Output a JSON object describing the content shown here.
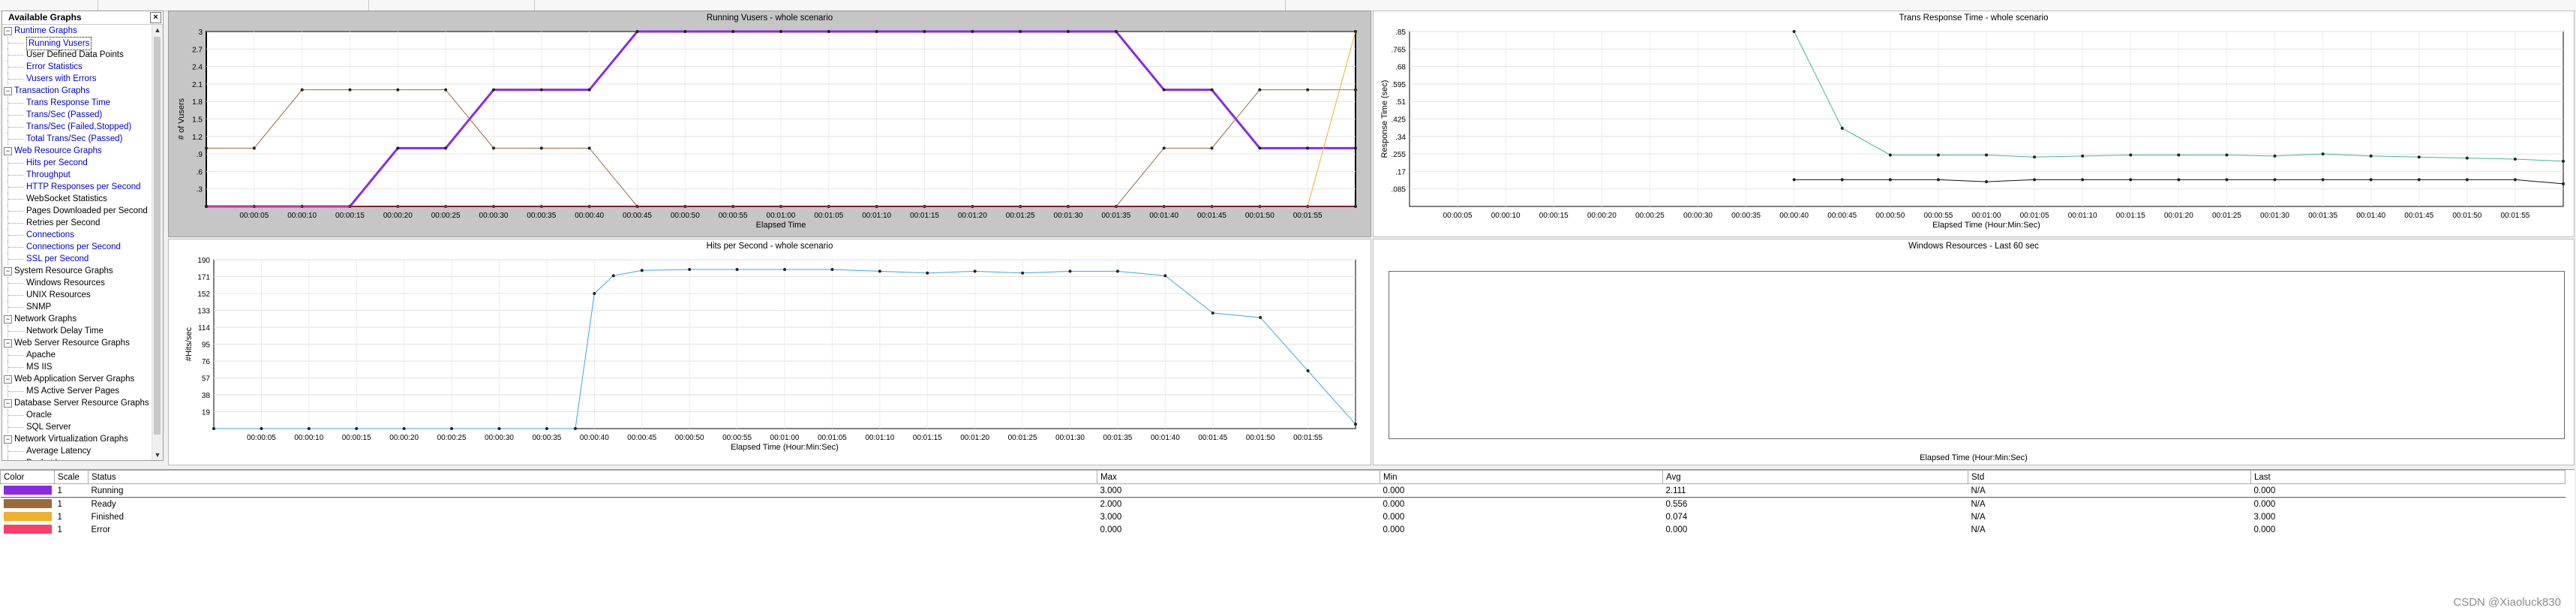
{
  "tree": {
    "title": "Available Graphs",
    "close": "×",
    "items": [
      {
        "label": "Runtime Graphs",
        "level": 0,
        "expander": "−",
        "style": "cat"
      },
      {
        "label": "Running Vusers",
        "level": 1,
        "style": "blue",
        "selected": true
      },
      {
        "label": "User Defined Data Points",
        "level": 1,
        "style": "black"
      },
      {
        "label": "Error Statistics",
        "level": 1,
        "style": "blue"
      },
      {
        "label": "Vusers with Errors",
        "level": 1,
        "style": "blue"
      },
      {
        "label": "Transaction Graphs",
        "level": 0,
        "expander": "−",
        "style": "cat"
      },
      {
        "label": "Trans Response Time",
        "level": 1,
        "style": "blue"
      },
      {
        "label": "Trans/Sec (Passed)",
        "level": 1,
        "style": "blue"
      },
      {
        "label": "Trans/Sec (Failed,Stopped)",
        "level": 1,
        "style": "blue"
      },
      {
        "label": "Total Trans/Sec (Passed)",
        "level": 1,
        "style": "blue"
      },
      {
        "label": "Web Resource Graphs",
        "level": 0,
        "expander": "−",
        "style": "cat"
      },
      {
        "label": "Hits per Second",
        "level": 1,
        "style": "blue"
      },
      {
        "label": "Throughput",
        "level": 1,
        "style": "blue"
      },
      {
        "label": "HTTP Responses per Second",
        "level": 1,
        "style": "blue"
      },
      {
        "label": "WebSocket Statistics",
        "level": 1,
        "style": "black"
      },
      {
        "label": "Pages Downloaded per Second",
        "level": 1,
        "style": "black"
      },
      {
        "label": "Retries per Second",
        "level": 1,
        "style": "black"
      },
      {
        "label": "Connections",
        "level": 1,
        "style": "blue"
      },
      {
        "label": "Connections per Second",
        "level": 1,
        "style": "blue"
      },
      {
        "label": "SSL per Second",
        "level": 1,
        "style": "blue"
      },
      {
        "label": "System Resource Graphs",
        "level": 0,
        "expander": "−",
        "style": "black"
      },
      {
        "label": "Windows Resources",
        "level": 1,
        "style": "black"
      },
      {
        "label": "UNIX Resources",
        "level": 1,
        "style": "black"
      },
      {
        "label": "SNMP",
        "level": 1,
        "style": "black"
      },
      {
        "label": "Network Graphs",
        "level": 0,
        "expander": "−",
        "style": "black"
      },
      {
        "label": "Network Delay Time",
        "level": 1,
        "style": "black"
      },
      {
        "label": "Web Server Resource Graphs",
        "level": 0,
        "expander": "−",
        "style": "black"
      },
      {
        "label": "Apache",
        "level": 1,
        "style": "black"
      },
      {
        "label": "MS IIS",
        "level": 1,
        "style": "black"
      },
      {
        "label": "Web Application Server Graphs",
        "level": 0,
        "expander": "−",
        "style": "black"
      },
      {
        "label": "MS Active Server Pages",
        "level": 1,
        "style": "black"
      },
      {
        "label": "Database Server Resource Graphs",
        "level": 0,
        "expander": "−",
        "style": "black"
      },
      {
        "label": "Oracle",
        "level": 1,
        "style": "black"
      },
      {
        "label": "SQL Server",
        "level": 1,
        "style": "black"
      },
      {
        "label": "Network Virtualization Graphs",
        "level": 0,
        "expander": "−",
        "style": "black"
      },
      {
        "label": "Average Latency",
        "level": 1,
        "style": "black"
      },
      {
        "label": "Packet Loss",
        "level": 1,
        "style": "black"
      }
    ]
  },
  "time_ticks": [
    "00:00:05",
    "00:00:10",
    "00:00:15",
    "00:00:20",
    "00:00:25",
    "00:00:30",
    "00:00:35",
    "00:00:40",
    "00:00:45",
    "00:00:50",
    "00:00:55",
    "00:01:00",
    "00:01:05",
    "00:01:10",
    "00:01:15",
    "00:01:20",
    "00:01:25",
    "00:01:30",
    "00:01:35",
    "00:01:40",
    "00:01:45",
    "00:01:50",
    "00:01:55"
  ],
  "chart_data": [
    {
      "id": "vusers",
      "type": "line",
      "title": "Running Vusers - whole scenario",
      "xlabel": "Elapsed Time",
      "ylabel": "# of Vusers",
      "yticks": [
        "3",
        "2.7",
        "2.4",
        "2.1",
        "1.8",
        "1.5",
        "1.2",
        ".9",
        ".6",
        ".3"
      ],
      "xlim": [
        0,
        120
      ],
      "ylim": [
        0,
        3
      ],
      "series": [
        {
          "name": "Running",
          "color": "#8a2be2",
          "width": 3,
          "x": [
            0,
            5,
            10,
            15,
            20,
            25,
            30,
            35,
            40,
            45,
            50,
            55,
            60,
            65,
            70,
            75,
            80,
            85,
            90,
            95,
            100,
            105,
            110,
            115,
            120
          ],
          "y": [
            0,
            0,
            0,
            0,
            1,
            1,
            2,
            2,
            2,
            3,
            3,
            3,
            3,
            3,
            3,
            3,
            3,
            3,
            3,
            3,
            2,
            2,
            1,
            1,
            1
          ]
        },
        {
          "name": "Ready",
          "color": "#9a6a3a",
          "width": 1,
          "x": [
            0,
            5,
            10,
            15,
            20,
            25,
            30,
            35,
            40,
            45,
            50,
            55,
            60,
            65,
            70,
            75,
            80,
            85,
            90,
            95,
            100,
            105,
            110,
            115,
            120
          ],
          "y": [
            1,
            1,
            2,
            2,
            2,
            2,
            1,
            1,
            1,
            0,
            0,
            0,
            0,
            0,
            0,
            0,
            0,
            0,
            0,
            0,
            1,
            1,
            2,
            2,
            2
          ]
        },
        {
          "name": "Finished",
          "color": "#f0b030",
          "width": 1,
          "x": [
            0,
            5,
            10,
            15,
            20,
            25,
            30,
            35,
            40,
            45,
            50,
            55,
            60,
            65,
            70,
            75,
            80,
            85,
            90,
            95,
            100,
            105,
            110,
            115,
            120
          ],
          "y": [
            0,
            0,
            0,
            0,
            0,
            0,
            0,
            0,
            0,
            0,
            0,
            0,
            0,
            0,
            0,
            0,
            0,
            0,
            0,
            0,
            0,
            0,
            0,
            0,
            3
          ]
        },
        {
          "name": "Error",
          "color": "#ff3c6e",
          "width": 1,
          "x": [
            0,
            120
          ],
          "y": [
            0,
            0
          ]
        }
      ]
    },
    {
      "id": "trt",
      "type": "line",
      "title": "Trans Response Time - whole scenario",
      "xlabel": "Elapsed Time (Hour:Min:Sec)",
      "ylabel": "Response Time (sec)",
      "yticks": [
        ".85",
        ".765",
        ".68",
        ".595",
        ".51",
        ".425",
        ".34",
        ".255",
        ".17",
        ".085"
      ],
      "xlim": [
        0,
        120
      ],
      "ylim": [
        0,
        0.85
      ],
      "series": [
        {
          "name": "",
          "color": "#3cb89a",
          "width": 1,
          "x": [
            40,
            45,
            50,
            55,
            60,
            65,
            70,
            75,
            80,
            85,
            90,
            95,
            100,
            105,
            110,
            115,
            120
          ],
          "y": [
            0.85,
            0.38,
            0.25,
            0.25,
            0.25,
            0.24,
            0.245,
            0.25,
            0.25,
            0.25,
            0.245,
            0.255,
            0.245,
            0.24,
            0.235,
            0.23,
            0.22
          ]
        },
        {
          "name": "",
          "color": "#111111",
          "width": 1,
          "x": [
            40,
            45,
            50,
            55,
            60,
            65,
            70,
            75,
            80,
            85,
            90,
            95,
            100,
            105,
            110,
            115,
            120
          ],
          "y": [
            0.13,
            0.13,
            0.13,
            0.13,
            0.12,
            0.13,
            0.13,
            0.13,
            0.13,
            0.13,
            0.13,
            0.13,
            0.13,
            0.13,
            0.13,
            0.13,
            0.11
          ]
        }
      ]
    },
    {
      "id": "hits",
      "type": "line",
      "title": "Hits per Second - whole scenario",
      "xlabel": "Elapsed Time (Hour:Min:Sec)",
      "ylabel": "#Hits/sec",
      "yticks": [
        "190",
        "171",
        "152",
        "133",
        "114",
        "95",
        "76",
        "57",
        "38",
        "19"
      ],
      "xlim": [
        0,
        120
      ],
      "ylim": [
        0,
        190
      ],
      "series": [
        {
          "name": "",
          "color": "#3aa8e0",
          "width": 1,
          "x": [
            0,
            5,
            10,
            15,
            20,
            25,
            30,
            35,
            38,
            40,
            42,
            45,
            50,
            55,
            60,
            65,
            70,
            75,
            80,
            85,
            90,
            95,
            100,
            105,
            110,
            115,
            120
          ],
          "y": [
            0,
            0,
            0,
            0,
            0,
            0,
            0,
            0,
            0,
            152,
            172,
            178,
            179,
            179,
            179,
            179,
            177,
            175,
            177,
            175,
            177,
            177,
            172,
            130,
            125,
            65,
            5
          ]
        }
      ]
    }
  ],
  "windows_resources": {
    "title": "Windows Resources - Last 60 sec",
    "xlabel": "Elapsed Time (Hour:Min:Sec)"
  },
  "legend": {
    "headers": [
      "Color",
      "Scale",
      "Status",
      "Max",
      "Min",
      "Avg",
      "Std",
      "Last"
    ],
    "rows": [
      {
        "color": "#8a2be2",
        "scale": "1",
        "status": "Running",
        "max": "3.000",
        "min": "0.000",
        "avg": "2.111",
        "std": "N/A",
        "last": "0.000"
      },
      {
        "color": "#9a6a3a",
        "scale": "1",
        "status": "Ready",
        "max": "2.000",
        "min": "0.000",
        "avg": "0.556",
        "std": "N/A",
        "last": "0.000"
      },
      {
        "color": "#f0b030",
        "scale": "1",
        "status": "Finished",
        "max": "3.000",
        "min": "0.000",
        "avg": "0.074",
        "std": "N/A",
        "last": "3.000"
      },
      {
        "color": "#ff3c6e",
        "scale": "1",
        "status": "Error",
        "max": "0.000",
        "min": "0.000",
        "avg": "0.000",
        "std": "N/A",
        "last": "0.000"
      }
    ]
  },
  "watermark": "CSDN @Xiaoluck830"
}
